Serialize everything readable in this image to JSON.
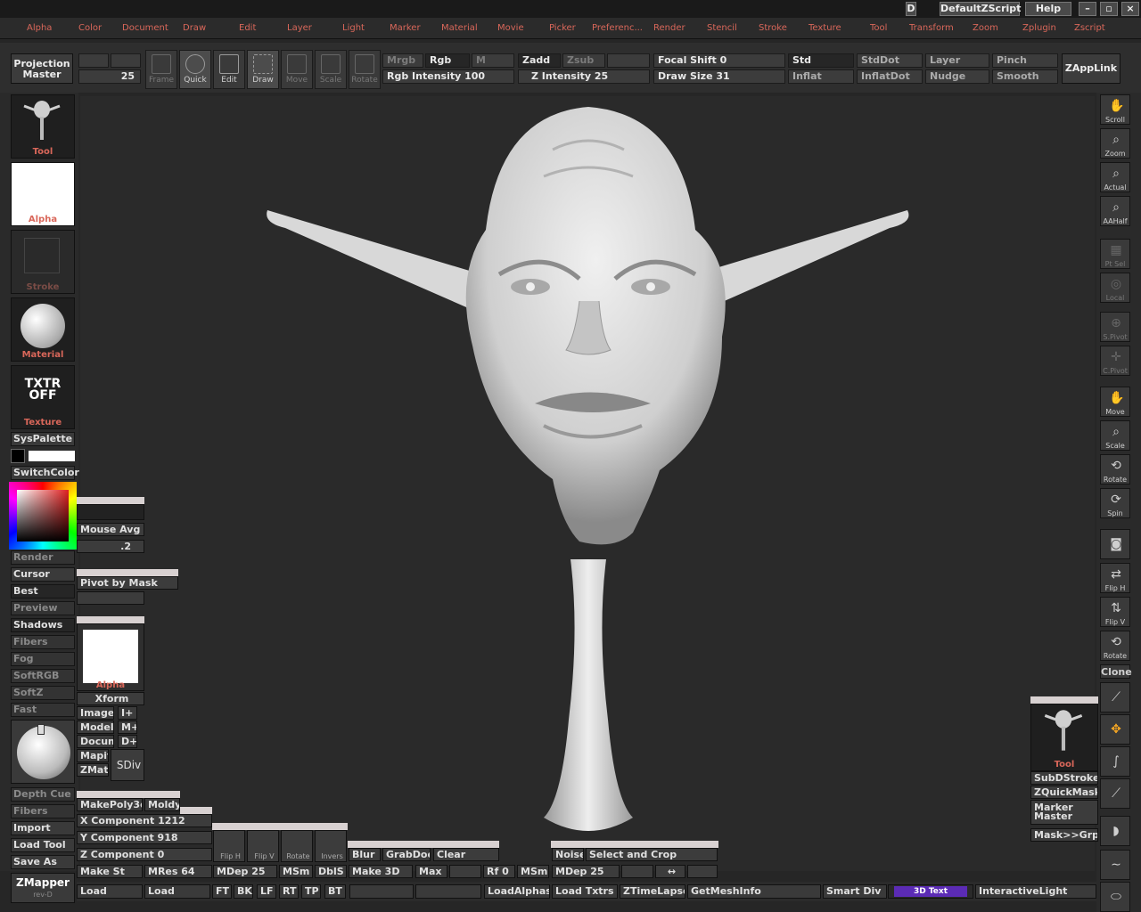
{
  "titlebar": {
    "script_name": "DefaultZScript",
    "help": "Help",
    "left_stub": "D"
  },
  "menu": [
    "Alpha",
    "Color",
    "Document",
    "Draw",
    "Edit",
    "Layer",
    "Light",
    "Marker",
    "Material",
    "Movie",
    "Picker",
    "Preferenc...",
    "Render",
    "Stencil",
    "Stroke",
    "Texture",
    "Tool",
    "Transform",
    "Zoom",
    "Zplugin",
    "Zscript"
  ],
  "topshelf": {
    "projection_master": "Projection Master",
    "edit_num": "25",
    "tools": {
      "frame": "Frame",
      "quick": "Quick",
      "edit": "Edit",
      "draw": "Draw",
      "move": "Move",
      "scale": "Scale",
      "rotate": "Rotate"
    },
    "mrgb": "Mrgb",
    "rgb": "Rgb",
    "m": "M",
    "zadd": "Zadd",
    "zsub": "Zsub",
    "rgb_intensity": "Rgb Intensity",
    "rgb_intensity_value": "100",
    "z_intensity": "Z Intensity",
    "z_intensity_value": "25",
    "focal_shift": "Focal Shift",
    "focal_shift_value": "0",
    "draw_size": "Draw Size",
    "draw_size_value": "31",
    "brushes": [
      "Std",
      "StdDot",
      "Layer",
      "Pinch",
      "Inflat",
      "InflatDot",
      "Nudge",
      "Smooth"
    ],
    "zapplink": "ZAppLink"
  },
  "lefttray": {
    "tool_label": "Tool",
    "alpha_label": "Alpha",
    "stroke_label": "Stroke",
    "material_label": "Material",
    "texture_label": "Texture",
    "txtr_off": "TXTR OFF",
    "syspalette": "SysPalette",
    "switchcolor": "SwitchColor",
    "render_buttons": [
      "Render",
      "Cursor",
      "Best",
      "Preview",
      "Shadows",
      "Fibers",
      "Fog",
      "SoftRGB",
      "SoftZ",
      "Fast"
    ],
    "bottom_buttons": [
      "Depth Cue",
      "Fibers",
      "Import",
      "Load Tool",
      "Save As"
    ],
    "zmapper": "ZMapper",
    "zmapper_rev": "rev-D"
  },
  "float": {
    "mouse_avg": "Mouse Avg",
    "mouse_avg_value": ".2",
    "pivot_by_mask": "Pivot by Mask",
    "alpha_label": "Alpha",
    "xform": "Xform",
    "image": "Image",
    "image_plus": "I+",
    "model": "Model",
    "model_plus": "M+",
    "docum": "Docum",
    "docum_plus": "D+",
    "mapit": "Mapit",
    "zmats": "ZMats",
    "sdiv": "SDiv",
    "makepoly3d": "MakePoly3d",
    "moldy": "Moldy",
    "x_component": "X Component",
    "x_value": "1212",
    "y_component": "Y Component",
    "y_value": "918",
    "z_component": "Z Component",
    "z_value": "0",
    "make_st": "Make St",
    "mres": "MRes",
    "mres_value": "64",
    "mdep": "MDep",
    "mdep_value": "25",
    "msm": "MSm",
    "dbls": "DblS",
    "flip_h": "Flip H",
    "flip_v": "Flip V",
    "rotate": "Rotate",
    "invers": "Invers",
    "blur": "Blur",
    "grabdoc": "GrabDoc",
    "clear": "Clear",
    "make_3d": "Make 3D",
    "max": "Max",
    "rf": "Rf",
    "rf_value": "0",
    "noise": "Noise",
    "select_and_crop": "Select and Crop",
    "mdep2_value": "25"
  },
  "righttray": {
    "buttons": [
      "Scroll",
      "Zoom",
      "Actual",
      "AAHalf",
      "Pt Sel",
      "Local",
      "S.Pivot",
      "C.Pivot",
      "Move",
      "Scale",
      "Rotate",
      "Spin",
      "",
      "Flip H",
      "Flip V",
      "Rotate"
    ],
    "clone": "Clone",
    "subdstroke": "SubDStroke",
    "zquickmask": "ZQuickMask",
    "marker_master": "Marker Master",
    "mask_grp": "Mask>>Grp",
    "tool_label": "Tool"
  },
  "bottombar": {
    "load1": "Load",
    "load2": "Load",
    "views": [
      "FT",
      "BK",
      "LF",
      "RT",
      "TP",
      "BT"
    ],
    "loadalphas": "LoadAlphas",
    "load_txtrs": "Load Txtrs",
    "ztimelapse": "ZTimeLapse",
    "getmeshinfo": "GetMeshInfo",
    "smart_div": "Smart Div",
    "text_3d": "3D Text",
    "interactivelight": "InteractiveLight"
  },
  "colors": {
    "menu_text": "#d9675a",
    "panel": "#2e2e2e",
    "button": "#3a3a3a",
    "model": "#e4e4e4",
    "text3d": "#5b2bb5"
  }
}
